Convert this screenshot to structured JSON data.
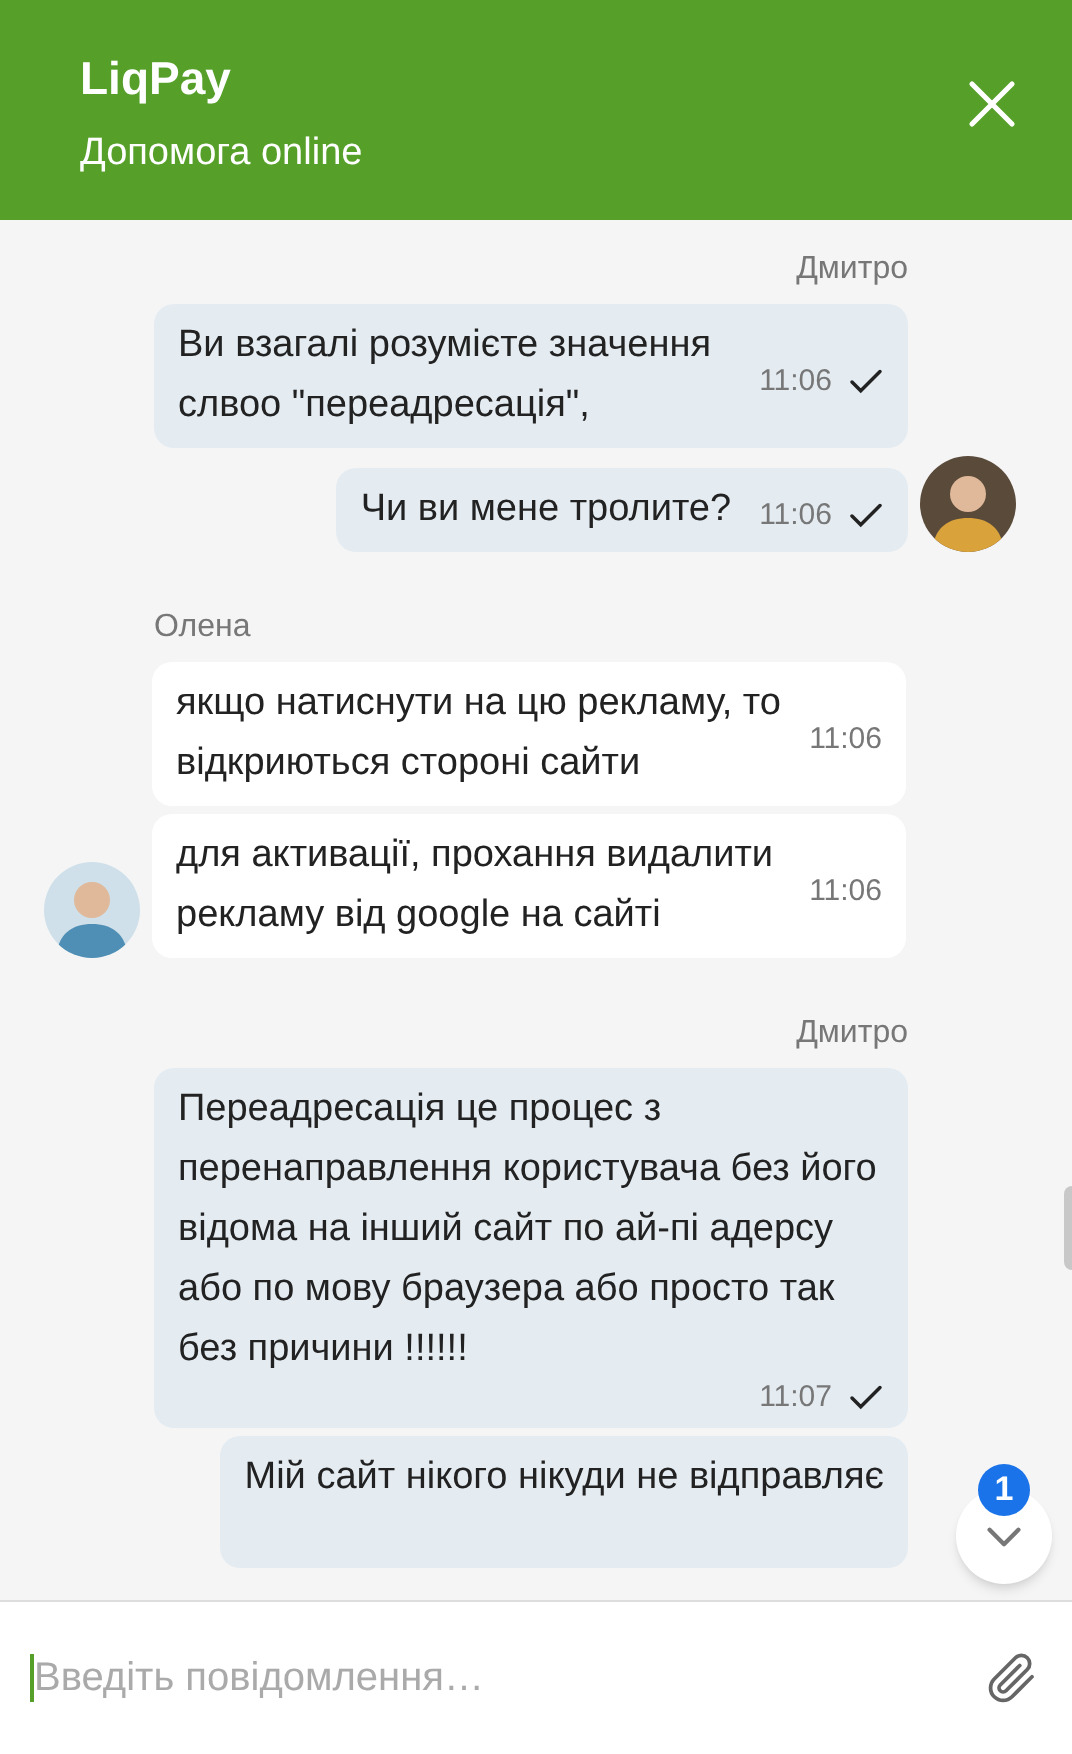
{
  "header": {
    "title": "LiqPay",
    "subtitle": "Допомога online"
  },
  "groups": [
    {
      "kind": "outgoing",
      "sender": "Дмитро",
      "avatar": true,
      "messages": [
        {
          "text": "Ви взагалі розумієте значення слвоо \"переадресація\",",
          "time": "11:06",
          "read": true
        },
        {
          "text": "Чи ви мене тролите?",
          "time": "11:06",
          "read": true
        }
      ]
    },
    {
      "kind": "incoming",
      "sender": "Олена",
      "avatar": true,
      "messages": [
        {
          "text": "якщо натиснути на цю рекламу, то відкриються стороні сайти",
          "time": "11:06"
        },
        {
          "text": "для активації, прохання видалити рекламу від google на сайті",
          "time": "11:06"
        }
      ]
    },
    {
      "kind": "outgoing",
      "sender": "Дмитро",
      "avatar": false,
      "messages": [
        {
          "text": "Переадресація це процес з перенаправлення користувача без його відома на інший сайт по ай-пі адерсу або по мову браузера або просто так без причини !!!!!!",
          "time": "11:07",
          "read": true
        },
        {
          "text": "Мій сайт нікого нікуди не відправляє"
        }
      ]
    }
  ],
  "scroll_button": {
    "badge": "1"
  },
  "composer": {
    "placeholder": "Введіть повідомлення…"
  }
}
